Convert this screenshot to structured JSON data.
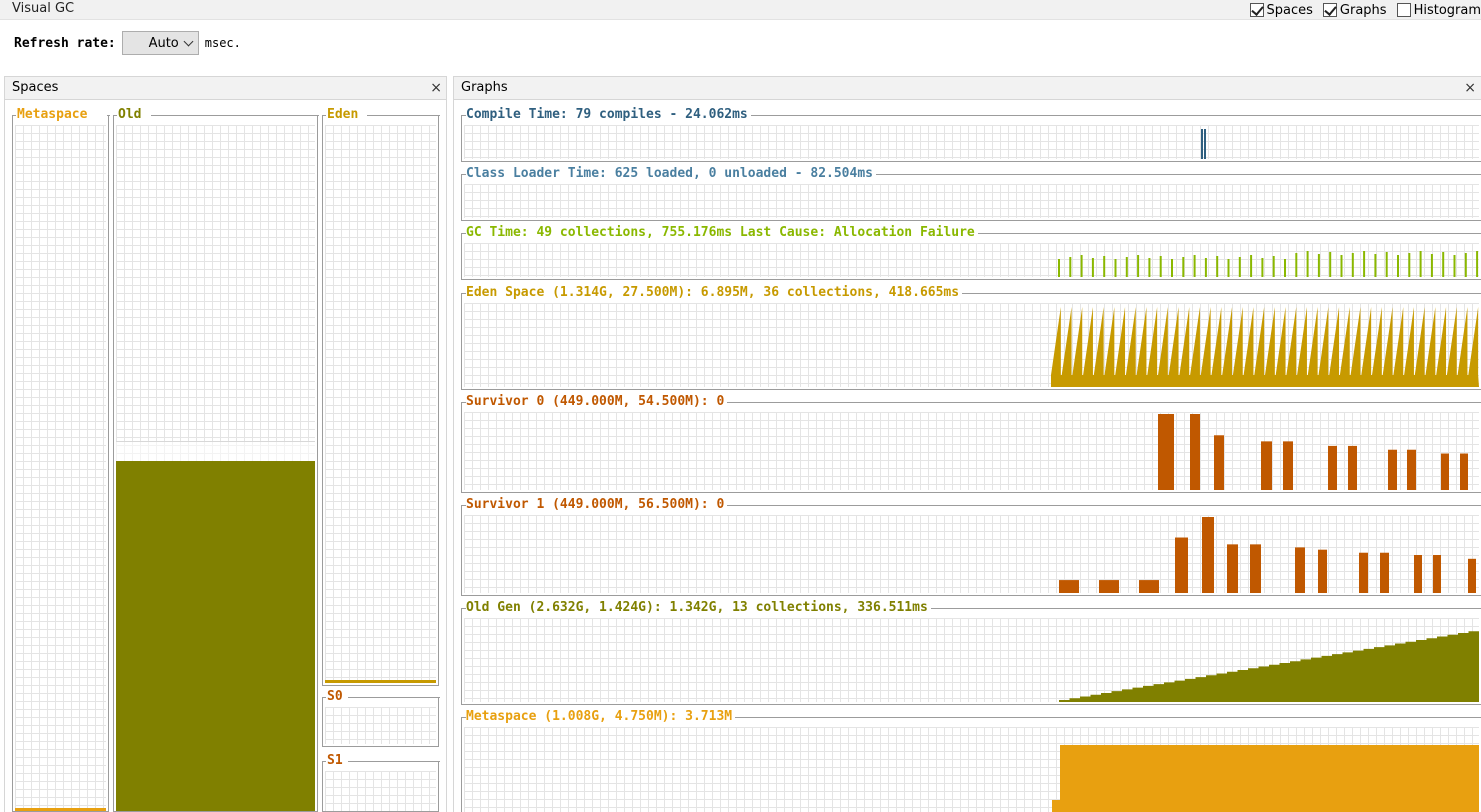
{
  "app": {
    "title": "Visual GC"
  },
  "toggles": [
    {
      "label": "Spaces",
      "checked": true
    },
    {
      "label": "Graphs",
      "checked": true
    },
    {
      "label": "Histogram",
      "checked": false
    }
  ],
  "refresh": {
    "label": "Refresh rate:",
    "value": "Auto",
    "unit": "msec."
  },
  "spaces_panel": {
    "title": "Spaces",
    "close": "×",
    "metaspace": {
      "label": "Metaspace",
      "color": "#e8a010",
      "fill": 0.0
    },
    "old": {
      "label": "Old",
      "color": "#808000",
      "fill": 0.51,
      "capacity": 0.54
    },
    "eden": {
      "label": "Eden",
      "color": "#c79a00",
      "fill": 0.005
    },
    "s0": {
      "label": "S0",
      "color": "#c05800",
      "fill": 0
    },
    "s1": {
      "label": "S1",
      "color": "#c05800",
      "fill": 0
    }
  },
  "graphs_panel": {
    "title": "Graphs",
    "close": "×",
    "graphs": [
      {
        "title": "Compile Time: 79 compiles - 24.062ms",
        "color": "#2f5f7f"
      },
      {
        "title": "Class Loader Time: 625 loaded, 0 unloaded - 82.504ms",
        "color": "#4a7fa0"
      },
      {
        "title": "GC Time: 49 collections, 755.176ms Last Cause: Allocation Failure",
        "color": "#8ab800"
      },
      {
        "title": "Eden Space (1.314G, 27.500M): 6.895M, 36 collections, 418.665ms",
        "color": "#c79a00"
      },
      {
        "title": "Survivor 0 (449.000M, 54.500M): 0",
        "color": "#c05800"
      },
      {
        "title": "Survivor 1 (449.000M, 56.500M): 0",
        "color": "#c05800"
      },
      {
        "title": "Old Gen (2.632G, 1.424G): 1.342G, 13 collections, 336.511ms",
        "color": "#808000"
      },
      {
        "title": "Metaspace (1.008G, 4.750M): 3.713M",
        "color": "#e8a010"
      }
    ]
  }
}
